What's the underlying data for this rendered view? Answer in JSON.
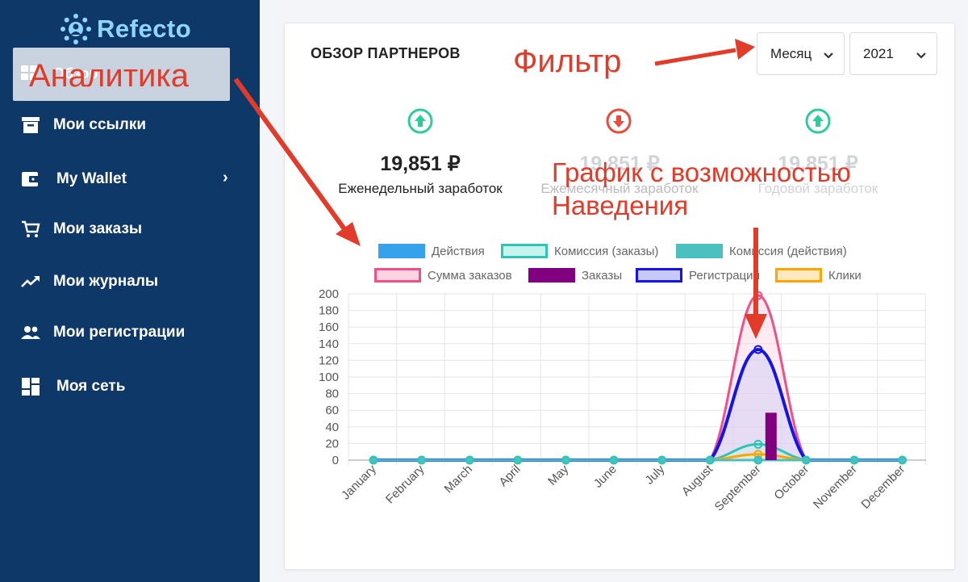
{
  "brand": {
    "name": "Refecto",
    "color": "#8fd6ff"
  },
  "sidebar": {
    "active_item": {
      "label": "Обзор",
      "icon": "dashboard-icon"
    },
    "items": [
      {
        "label": "Мои ссылки",
        "icon": "archive-icon"
      },
      {
        "label": "My Wallet",
        "icon": "wallet-icon",
        "has_submenu": true
      },
      {
        "label": "Мои заказы",
        "icon": "cart-icon"
      },
      {
        "label": "Мои журналы",
        "icon": "trending-up-icon"
      },
      {
        "label": "Мои регистрации",
        "icon": "users-icon"
      },
      {
        "label": "Моя сеть",
        "icon": "grid-icon"
      }
    ]
  },
  "card": {
    "title": "ОБЗОР ПАРТНЕРОВ",
    "period_select": {
      "value": "Месяц"
    },
    "year_select": {
      "value": "2021"
    }
  },
  "stats": [
    {
      "value": "19,851 ₽",
      "label": "Еженедельный заработок",
      "trend": "up",
      "color": "#2ecc9a"
    },
    {
      "value": "19,851 ₽",
      "label": "Ежемесячный заработок",
      "trend": "down",
      "color": "#e74c3c"
    },
    {
      "value": "19,851 ₽",
      "label": "Годовой заработок",
      "trend": "up",
      "color": "#2ecc9a"
    }
  ],
  "annotations": {
    "analytics": "Аналитика",
    "filter": "Фильтр",
    "hover_line1": "График с возможностью",
    "hover_line2": "Наведения"
  },
  "chart_data": {
    "type": "line",
    "categories": [
      "January",
      "February",
      "March",
      "April",
      "May",
      "June",
      "July",
      "August",
      "September",
      "October",
      "November",
      "December"
    ],
    "ylim": [
      0,
      200
    ],
    "yticks": [
      0,
      20,
      40,
      60,
      80,
      100,
      120,
      140,
      160,
      180,
      200
    ],
    "grid": true,
    "legend_position": "top",
    "series": [
      {
        "name": "Действия",
        "kind": "line",
        "color": "#36a2eb",
        "fill": "#36a2eb",
        "values": [
          0,
          0,
          0,
          0,
          0,
          0,
          0,
          0,
          0,
          0,
          0,
          0
        ]
      },
      {
        "name": "Комиссия (заказы)",
        "kind": "line",
        "color": "#2ec4b6",
        "fill": "#c8f2ee",
        "values": [
          0,
          0,
          0,
          0,
          0,
          0,
          0,
          0,
          19,
          0,
          0,
          0
        ]
      },
      {
        "name": "Комиссия (действия)",
        "kind": "line",
        "color": "#4bc0c0",
        "fill": "#4bc0c0",
        "values": [
          0,
          0,
          0,
          0,
          0,
          0,
          0,
          0,
          0,
          0,
          0,
          0
        ]
      },
      {
        "name": "Сумма заказов",
        "kind": "line",
        "color": "#f0508a",
        "fill": "#fcd3e1",
        "values": [
          0,
          0,
          0,
          0,
          0,
          0,
          0,
          0,
          198,
          0,
          0,
          0
        ]
      },
      {
        "name": "Заказы",
        "kind": "bar",
        "color": "#800080",
        "fill": "#800080",
        "values": [
          0,
          0,
          0,
          0,
          0,
          0,
          0,
          0,
          57,
          0,
          0,
          0
        ]
      },
      {
        "name": "Регистрации",
        "kind": "line",
        "color": "#1414e6",
        "fill": "#c9c9f7",
        "values": [
          0,
          0,
          0,
          0,
          0,
          0,
          0,
          0,
          133,
          0,
          0,
          0
        ]
      },
      {
        "name": "Клики",
        "kind": "line",
        "color": "#ffa500",
        "fill": "#ffe8c2",
        "values": [
          0,
          0,
          0,
          0,
          0,
          0,
          0,
          0,
          7,
          0,
          0,
          0
        ]
      }
    ]
  }
}
